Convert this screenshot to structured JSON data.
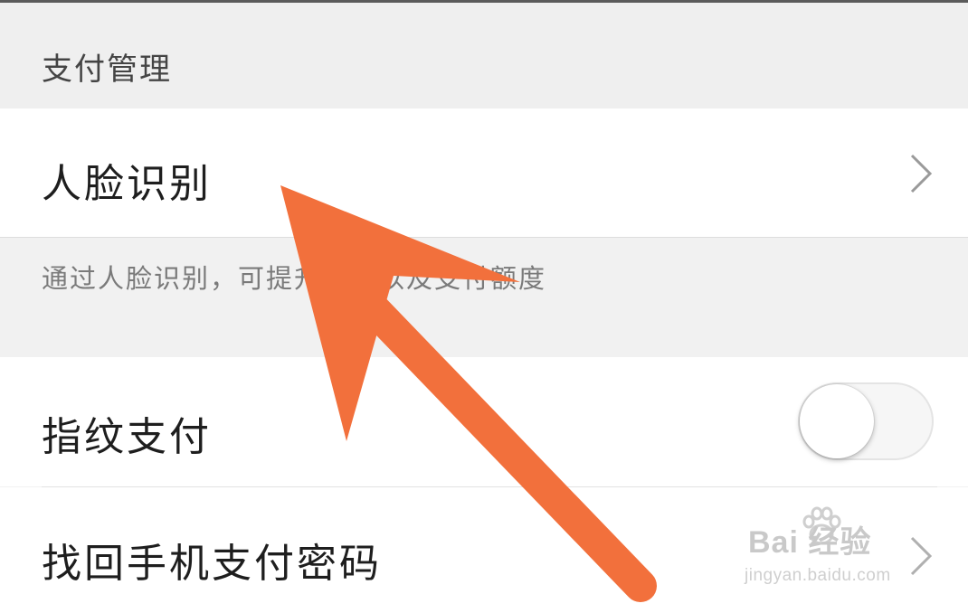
{
  "section": {
    "title": "支付管理"
  },
  "face_recognition": {
    "label": "人脸识别",
    "description": "通过人脸识别，可提升安全以及支付额度"
  },
  "fingerprint": {
    "label": "指纹支付",
    "enabled": false
  },
  "recover_password": {
    "label": "找回手机支付密码"
  },
  "watermark": {
    "brand": "Bai 经验",
    "url": "jingyan.baidu.com"
  },
  "colors": {
    "arrow": "#f2703c",
    "background": "#f1f1f1",
    "row": "#ffffff"
  },
  "icons": {
    "face_chevron": "chevron-right-icon",
    "password_chevron": "chevron-right-icon",
    "annotation": "arrow-annotation-icon",
    "paw": "paw-icon"
  }
}
